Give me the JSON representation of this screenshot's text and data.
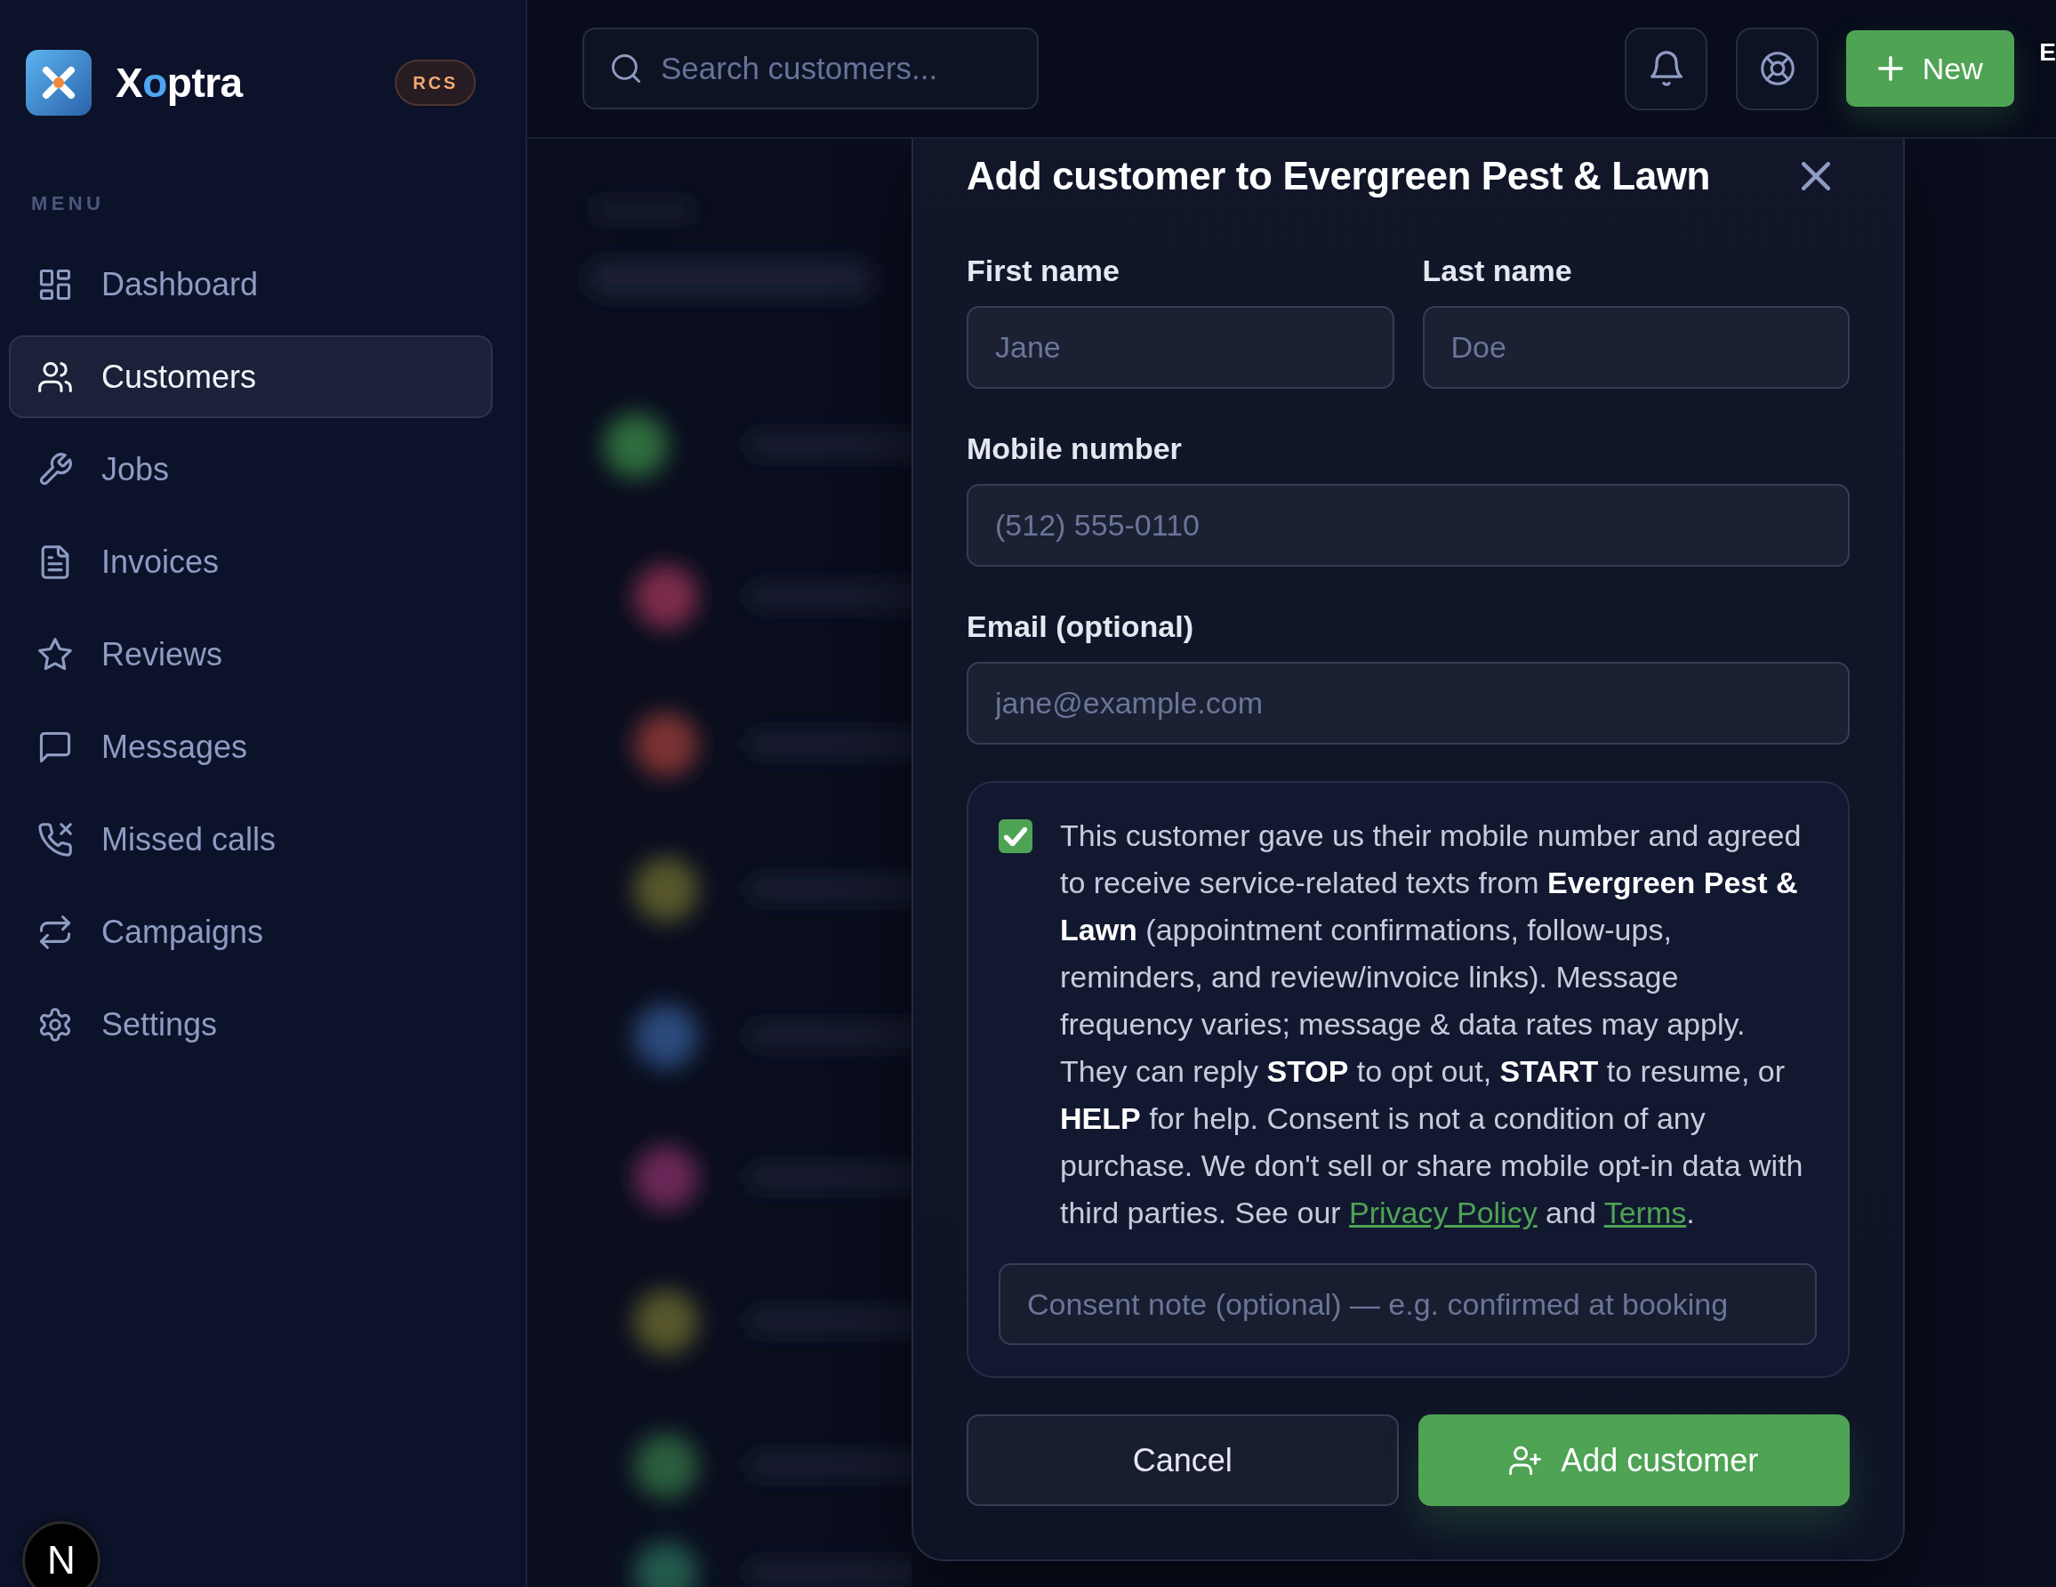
{
  "sidebar": {
    "brand": {
      "parts": [
        {
          "text": "X",
          "accent": false
        },
        {
          "text": "o",
          "accent": true
        },
        {
          "text": "ptra",
          "accent": false
        }
      ]
    },
    "badge": "RCS",
    "menu_heading": "MENU",
    "items": [
      {
        "label": "Dashboard",
        "selected": false
      },
      {
        "label": "Customers",
        "selected": true
      },
      {
        "label": "Jobs",
        "selected": false
      },
      {
        "label": "Invoices",
        "selected": false
      },
      {
        "label": "Reviews",
        "selected": false
      },
      {
        "label": "Messages",
        "selected": false
      },
      {
        "label": "Missed calls",
        "selected": false
      },
      {
        "label": "Campaigns",
        "selected": false
      },
      {
        "label": "Settings",
        "selected": false
      }
    ],
    "dev_indicator": {
      "label": "N"
    }
  },
  "topbar": {
    "search": {
      "placeholder": "Search customers..."
    },
    "new_button": {
      "label": "New"
    },
    "edge_text": "E"
  },
  "modal": {
    "title": "Add customer to Evergreen Pest & Lawn",
    "field_rows": [
      [
        {
          "label": "First name",
          "placeholder": "Jane"
        },
        {
          "label": "Last name",
          "placeholder": "Doe"
        }
      ],
      [
        {
          "label": "Mobile number",
          "placeholder": "(512) 555-0110"
        }
      ],
      [
        {
          "label": "Email (optional)",
          "placeholder": "jane@example.com"
        }
      ]
    ],
    "consent": {
      "checked": true,
      "paragraph": [
        {
          "kind": "text",
          "text": "This customer gave us their mobile number and agreed to receive service-related texts from **Evergreen Pest & Lawn** (appointment confirmations, follow-ups, reminders, and review/invoice links). Message frequency varies; message & data rates may apply. They can reply **STOP** to opt out, **START** to resume, or **HELP** for help. Consent is not a condition of any purchase. We don't sell or share mobile opt-in data with third parties. See our "
        },
        {
          "kind": "link",
          "text": "Privacy Policy"
        },
        {
          "kind": "text",
          "text": " and "
        },
        {
          "kind": "link",
          "text": "Terms"
        },
        {
          "kind": "text",
          "text": "."
        }
      ],
      "note": {
        "placeholder": "Consent note (optional) — e.g. confirmed at booking"
      }
    },
    "buttons": [
      {
        "label": "Cancel",
        "kind": "secondary"
      },
      {
        "label": "Add customer",
        "kind": "primary"
      }
    ]
  }
}
